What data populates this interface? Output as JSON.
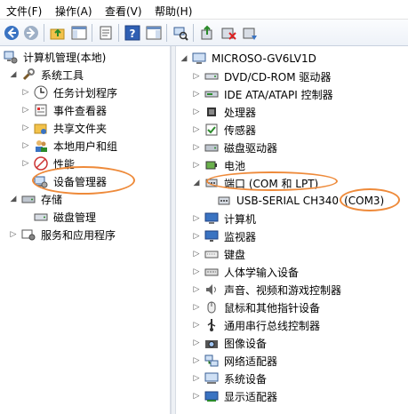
{
  "menu": {
    "file": "文件(F)",
    "action": "操作(A)",
    "view": "查看(V)",
    "help": "帮助(H)"
  },
  "toolbar": {
    "icons": [
      "back-arrow-icon",
      "forward-arrow-icon",
      "up-folder-icon",
      "show-hide-tree-icon",
      "properties-icon",
      "help-icon",
      "show-hide-action-pane-icon",
      "scan-hardware-icon",
      "update-driver-icon",
      "uninstall-icon",
      "disable-icon"
    ]
  },
  "left_tree": {
    "root": "计算机管理(本地)",
    "system_tools": "系统工具",
    "task_scheduler": "任务计划程序",
    "event_viewer": "事件查看器",
    "shared_folders": "共享文件夹",
    "local_users": "本地用户和组",
    "performance": "性能",
    "device_manager": "设备管理器",
    "storage": "存储",
    "disk_management": "磁盘管理",
    "services": "服务和应用程序"
  },
  "right_tree": {
    "computer": "MICROSO-GV6LV1D",
    "categories": [
      {
        "label": "DVD/CD-ROM 驱动器",
        "icon": "dvd-drive-icon"
      },
      {
        "label": "IDE ATA/ATAPI 控制器",
        "icon": "ide-controller-icon"
      },
      {
        "label": "处理器",
        "icon": "processor-icon"
      },
      {
        "label": "传感器",
        "icon": "sensor-icon"
      },
      {
        "label": "磁盘驱动器",
        "icon": "disk-drive-icon"
      },
      {
        "label": "电池",
        "icon": "battery-icon"
      },
      {
        "label": "端口 (COM 和 LPT)",
        "icon": "port-icon"
      }
    ],
    "port_child": "USB-SERIAL CH340",
    "port_child_com": "(COM3)",
    "categories_after": [
      {
        "label": "计算机",
        "icon": "computer-icon"
      },
      {
        "label": "监视器",
        "icon": "monitor-icon"
      },
      {
        "label": "键盘",
        "icon": "keyboard-icon"
      },
      {
        "label": "人体学输入设备",
        "icon": "hid-icon"
      },
      {
        "label": "声音、视频和游戏控制器",
        "icon": "sound-icon"
      },
      {
        "label": "鼠标和其他指针设备",
        "icon": "mouse-icon"
      },
      {
        "label": "通用串行总线控制器",
        "icon": "usb-icon"
      },
      {
        "label": "图像设备",
        "icon": "camera-icon"
      },
      {
        "label": "网络适配器",
        "icon": "network-icon"
      },
      {
        "label": "系统设备",
        "icon": "system-device-icon"
      },
      {
        "label": "显示适配器",
        "icon": "display-adapter-icon"
      }
    ]
  },
  "colors": {
    "highlight": "#ee8a3a",
    "accent": "#3a73c2"
  }
}
